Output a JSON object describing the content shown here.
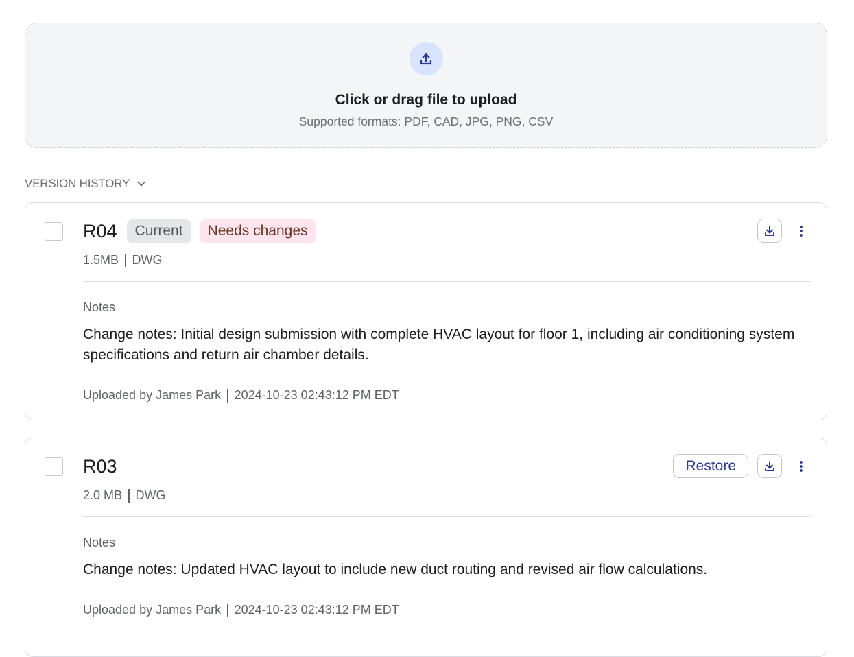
{
  "upload": {
    "title": "Click or drag file to upload",
    "formats": "Supported formats: PDF, CAD, JPG, PNG, CSV",
    "icon": "upload-icon"
  },
  "version_history": {
    "label": "VERSION HISTORY",
    "toggle_icon": "chevron-down-icon",
    "versions": [
      {
        "id": "R04",
        "badges": [
          "Current",
          "Needs changes"
        ],
        "size": "1.5MB",
        "type": "DWG",
        "notes_label": "Notes",
        "notes": "Change notes: Initial design submission with complete HVAC layout for floor 1, including air conditioning system specifications and return air chamber details.",
        "uploaded_by": "Uploaded by James Park",
        "timestamp": "2024-10-23 02:43:12 PM EDT"
      },
      {
        "id": "R03",
        "restore_label": "Restore",
        "size": "2.0 MB",
        "type": "DWG",
        "notes_label": "Notes",
        "notes": "Change notes: Updated HVAC layout to include new duct routing and revised air flow calculations.",
        "uploaded_by": "Uploaded by James Park",
        "timestamp": "2024-10-23 02:43:12 PM EDT"
      }
    ]
  },
  "colors": {
    "accent": "#2b3a8c",
    "upload_circle": "#d7e4fb",
    "badge_current_bg": "#e5e6ea",
    "badge_changes_bg": "#fde4ee",
    "badge_changes_text": "#6b3a24"
  }
}
